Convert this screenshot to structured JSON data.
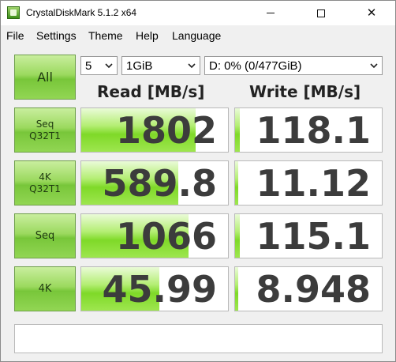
{
  "window": {
    "title": "CrystalDiskMark 5.1.2 x64",
    "controls": {
      "minimize": "—",
      "maximize": "□",
      "close": "✕"
    }
  },
  "menu": [
    "File",
    "Settings",
    "Theme",
    "Help",
    "Language"
  ],
  "toolbar": {
    "all_button": "All",
    "count": "5",
    "size": "1GiB",
    "drive": "D: 0% (0/477GiB)"
  },
  "headers": {
    "read": "Read [MB/s]",
    "write": "Write [MB/s]"
  },
  "tests": [
    {
      "label_line1": "Seq",
      "label_line2": "Q32T1",
      "read": "1802",
      "write": "118.1",
      "read_fill": 0.78,
      "write_fill": 0.03
    },
    {
      "label_line1": "4K",
      "label_line2": "Q32T1",
      "read": "589.8",
      "write": "11.12",
      "read_fill": 0.66,
      "write_fill": 0.02
    },
    {
      "label_line1": "Seq",
      "label_line2": "",
      "read": "1066",
      "write": "115.1",
      "read_fill": 0.73,
      "write_fill": 0.03
    },
    {
      "label_line1": "4K",
      "label_line2": "",
      "read": "45.99",
      "write": "8.948",
      "read_fill": 0.53,
      "write_fill": 0.02
    }
  ],
  "status": "",
  "colors": {
    "accent_green": "#7fd928",
    "button_green": "#9bd95e",
    "value_text": "#3c3c3c"
  }
}
